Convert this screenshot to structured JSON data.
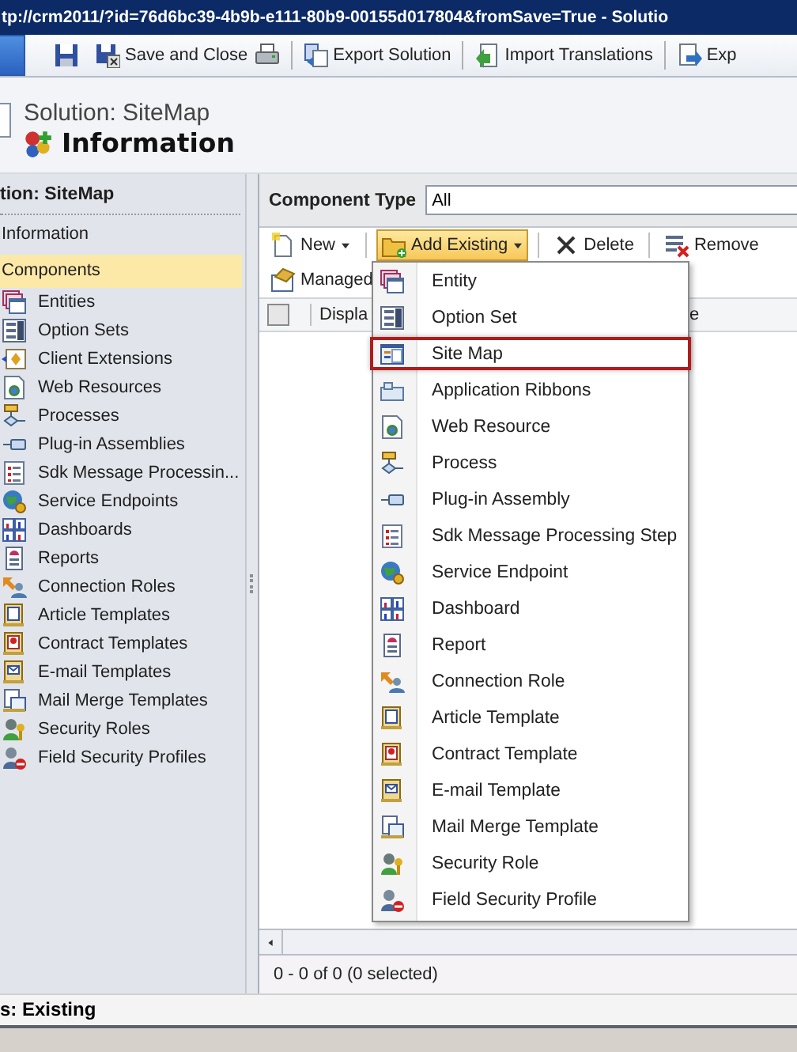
{
  "window": {
    "title": "tp://crm2011/?id=76d6bc39-4b9b-e111-80b9-00155d017804&fromSave=True - Solutio"
  },
  "toolbar": [
    {
      "kind": "icon"
    },
    {
      "kind": "button",
      "label": "Save and Close"
    },
    {
      "kind": "icon"
    },
    {
      "kind": "button",
      "label": "Export Solution"
    },
    {
      "kind": "button",
      "label": "Import Translations"
    },
    {
      "kind": "button",
      "label": "Exp"
    }
  ],
  "header": {
    "subtitle": "Solution: SiteMap",
    "title": "Information"
  },
  "nav": {
    "heading": "tion: SiteMap",
    "items": [
      {
        "label": "Information",
        "selected": false
      },
      {
        "label": "Components",
        "selected": true,
        "children": [
          {
            "label": "Entities"
          },
          {
            "label": "Option Sets"
          },
          {
            "label": "Client Extensions"
          },
          {
            "label": "Web Resources"
          },
          {
            "label": "Processes"
          },
          {
            "label": "Plug-in Assemblies"
          },
          {
            "label": "Sdk Message Processin..."
          },
          {
            "label": "Service Endpoints"
          },
          {
            "label": "Dashboards"
          },
          {
            "label": "Reports"
          },
          {
            "label": "Connection Roles"
          },
          {
            "label": "Article Templates"
          },
          {
            "label": "Contract Templates"
          },
          {
            "label": "E-mail Templates"
          },
          {
            "label": "Mail Merge Templates"
          },
          {
            "label": "Security Roles"
          },
          {
            "label": "Field Security Profiles"
          }
        ]
      }
    ]
  },
  "filter": {
    "label": "Component Type",
    "value": "All"
  },
  "commands": [
    {
      "label": "New",
      "kind": "dropdown",
      "pressed": false
    },
    {
      "label": "Add Existing",
      "kind": "dropdown",
      "pressed": true
    },
    {
      "label": "Delete",
      "kind": "button",
      "pressed": false
    },
    {
      "label": "Remove",
      "kind": "button",
      "pressed": false
    }
  ],
  "commands_row2": [
    {
      "label": "Managed"
    }
  ],
  "grid": {
    "select_all": {
      "checked": false
    },
    "columns": [
      {
        "label": "Displa"
      },
      {
        "label": "e"
      }
    ],
    "pager": "0 - 0 of 0 (0 selected)"
  },
  "menu": [
    {
      "label": "Entity",
      "selected": false
    },
    {
      "label": "Option Set",
      "selected": false
    },
    {
      "label": "Site Map",
      "selected": true
    },
    {
      "label": "Application Ribbons",
      "selected": false
    },
    {
      "label": "Web Resource",
      "selected": false
    },
    {
      "label": "Process",
      "selected": false
    },
    {
      "label": "Plug-in Assembly",
      "selected": false
    },
    {
      "label": "Sdk Message Processing Step",
      "selected": false
    },
    {
      "label": "Service Endpoint",
      "selected": false
    },
    {
      "label": "Dashboard",
      "selected": false
    },
    {
      "label": "Report",
      "selected": false
    },
    {
      "label": "Connection Role",
      "selected": false
    },
    {
      "label": "Article Template",
      "selected": false
    },
    {
      "label": "Contract Template",
      "selected": false
    },
    {
      "label": "E-mail Template",
      "selected": false
    },
    {
      "label": "Mail Merge Template",
      "selected": false
    },
    {
      "label": "Security Role",
      "selected": false
    },
    {
      "label": "Field Security Profile",
      "selected": false
    }
  ],
  "status_bar": "s: Existing"
}
